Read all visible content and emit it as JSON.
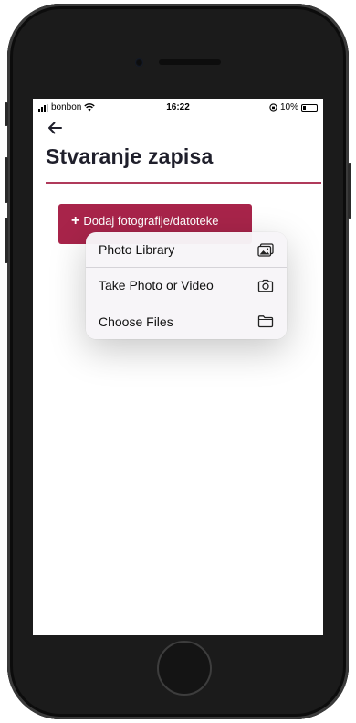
{
  "status_bar": {
    "carrier": "bonbon",
    "time": "16:22",
    "battery": "10%"
  },
  "header": {
    "back_icon": "arrow-left-icon",
    "title": "Stvaranje zapisa"
  },
  "add_button": {
    "plus": "+",
    "label": "Dodaj fotografije/datoteke"
  },
  "menu": {
    "items": [
      {
        "label": "Photo Library",
        "icon": "photo-library-icon"
      },
      {
        "label": "Take Photo or Video",
        "icon": "camera-icon"
      },
      {
        "label": "Choose Files",
        "icon": "folder-icon"
      }
    ]
  },
  "colors": {
    "accent": "#a8244a",
    "divider": "#b03a5b"
  }
}
